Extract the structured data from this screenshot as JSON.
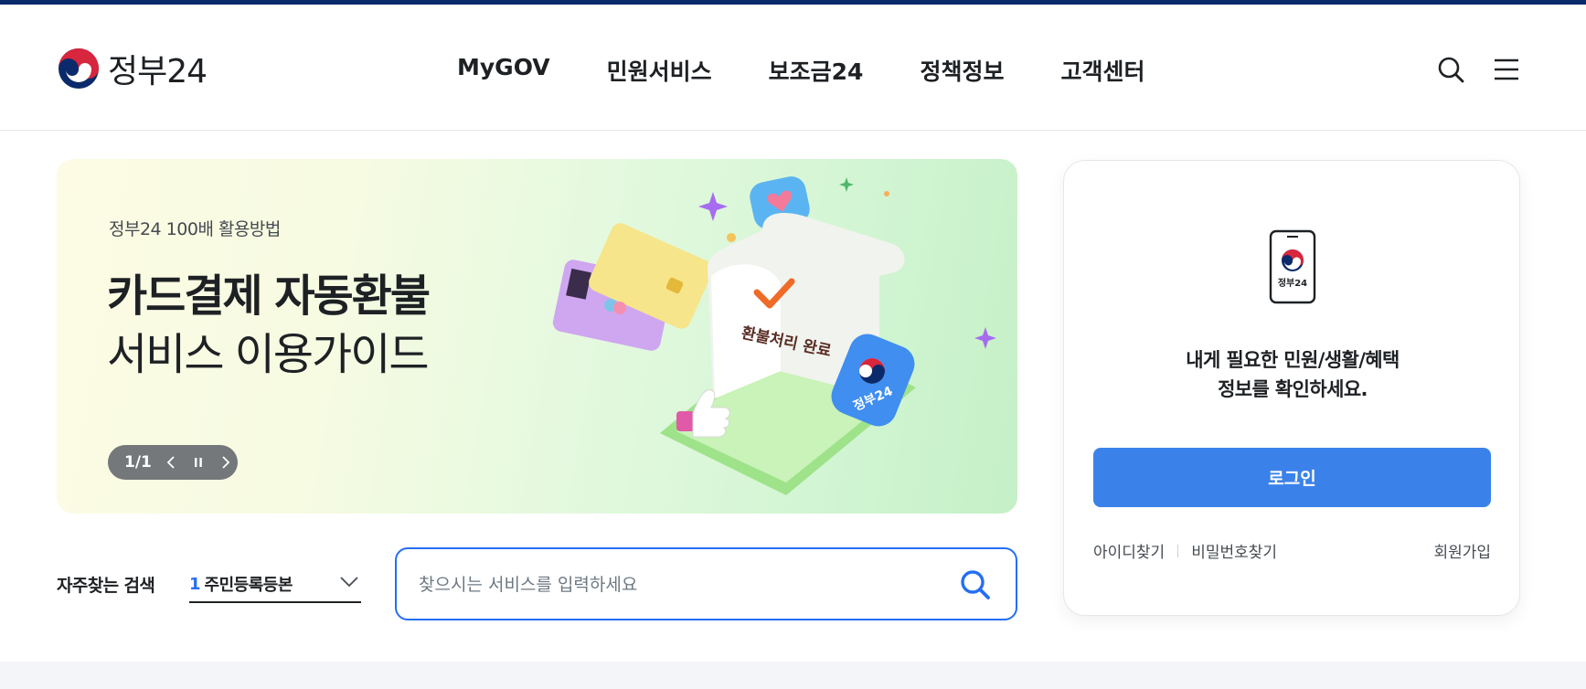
{
  "brand": {
    "logo_text": "정부24"
  },
  "nav": {
    "items": [
      "MyGOV",
      "민원서비스",
      "보조금24",
      "정책정보",
      "고객센터"
    ]
  },
  "header_icons": [
    "search-icon",
    "menu-icon"
  ],
  "banner": {
    "subtitle": "정부24 100배 활용방법",
    "title_bold": "카드결제 자동환불",
    "title_light": "서비스 이용가이드",
    "slide_counter": "1/1",
    "art_receipt_text": "환불처리 완료",
    "art_badge_text": "정부24"
  },
  "login": {
    "phone_label": "정부24",
    "message_line1": "내게 필요한 민원/생활/혜택",
    "message_line2": "정보를 확인하세요.",
    "button_label": "로그인",
    "find_id": "아이디찾기",
    "find_password": "비밀번호찾기",
    "signup": "회원가입"
  },
  "frequent_search": {
    "label": "자주찾는 검색",
    "rank": "1",
    "value": "주민등록등본"
  },
  "search": {
    "placeholder": "찾으시는 서비스를 입력하세요"
  },
  "colors": {
    "brand_navy": "#0b2a6b",
    "primary_blue": "#3a82ea",
    "search_border": "#256ef4"
  }
}
